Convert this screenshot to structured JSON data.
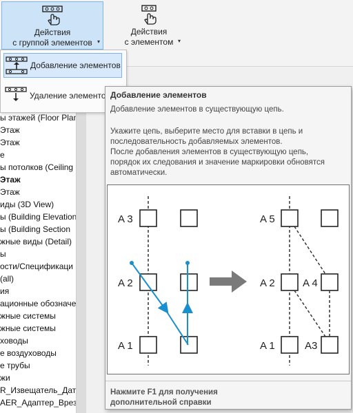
{
  "ribbon": {
    "group_button": {
      "line1": "Действия",
      "line2": "с группой элементов"
    },
    "element_button": {
      "line1": "Действия",
      "line2": "с элементом"
    }
  },
  "dropdown": {
    "items": [
      {
        "label": "Добавление элементов",
        "icon": "add-elements-icon",
        "selected": true
      },
      {
        "label": "Удаление элементов",
        "icon": "remove-elements-icon",
        "selected": false
      }
    ]
  },
  "browser": {
    "items": [
      "ы этажей (Floor Plan",
      "Этаж",
      "Этаж",
      "е",
      "ы потолков (Ceiling P",
      "Этаж",
      "Этаж",
      "иды (3D View)",
      "ы (Building Elevation",
      "ы (Building Section",
      "жные виды (Detail)",
      "ы",
      "ости/Спецификаци",
      "(all)",
      "ия",
      "ационные обозначе",
      "жные системы",
      "жные системы",
      "ховоды",
      "е воздуховоды",
      "е трубы",
      "жи",
      "R_Извещатель_Датч",
      "AER_Адаптер_Врезн"
    ]
  },
  "tooltip": {
    "title": "Добавление элементов",
    "description": "Добавление элементов в существующую цепь.",
    "body_lines": [
      "Укажите цепь, выберите место для вставки в цепь и",
      "последовательность добавляемых элементов.",
      "После добавления элементов в существующую цепь,",
      "порядок их следования и значение маркировки обновятся",
      "автоматически."
    ],
    "figure": {
      "left": {
        "labels": [
          "A 3",
          "A 2",
          "A 1"
        ]
      },
      "right": {
        "labels": [
          "A 5",
          "A 2",
          "A 4",
          "A 1",
          "A3"
        ]
      },
      "colors": {
        "path": "#1a8fd0",
        "arrow": "#7a7a7a",
        "line": "#333333"
      }
    },
    "help_line1": "Нажмите F1 для получения",
    "help_line2": "дополнительной справки"
  }
}
